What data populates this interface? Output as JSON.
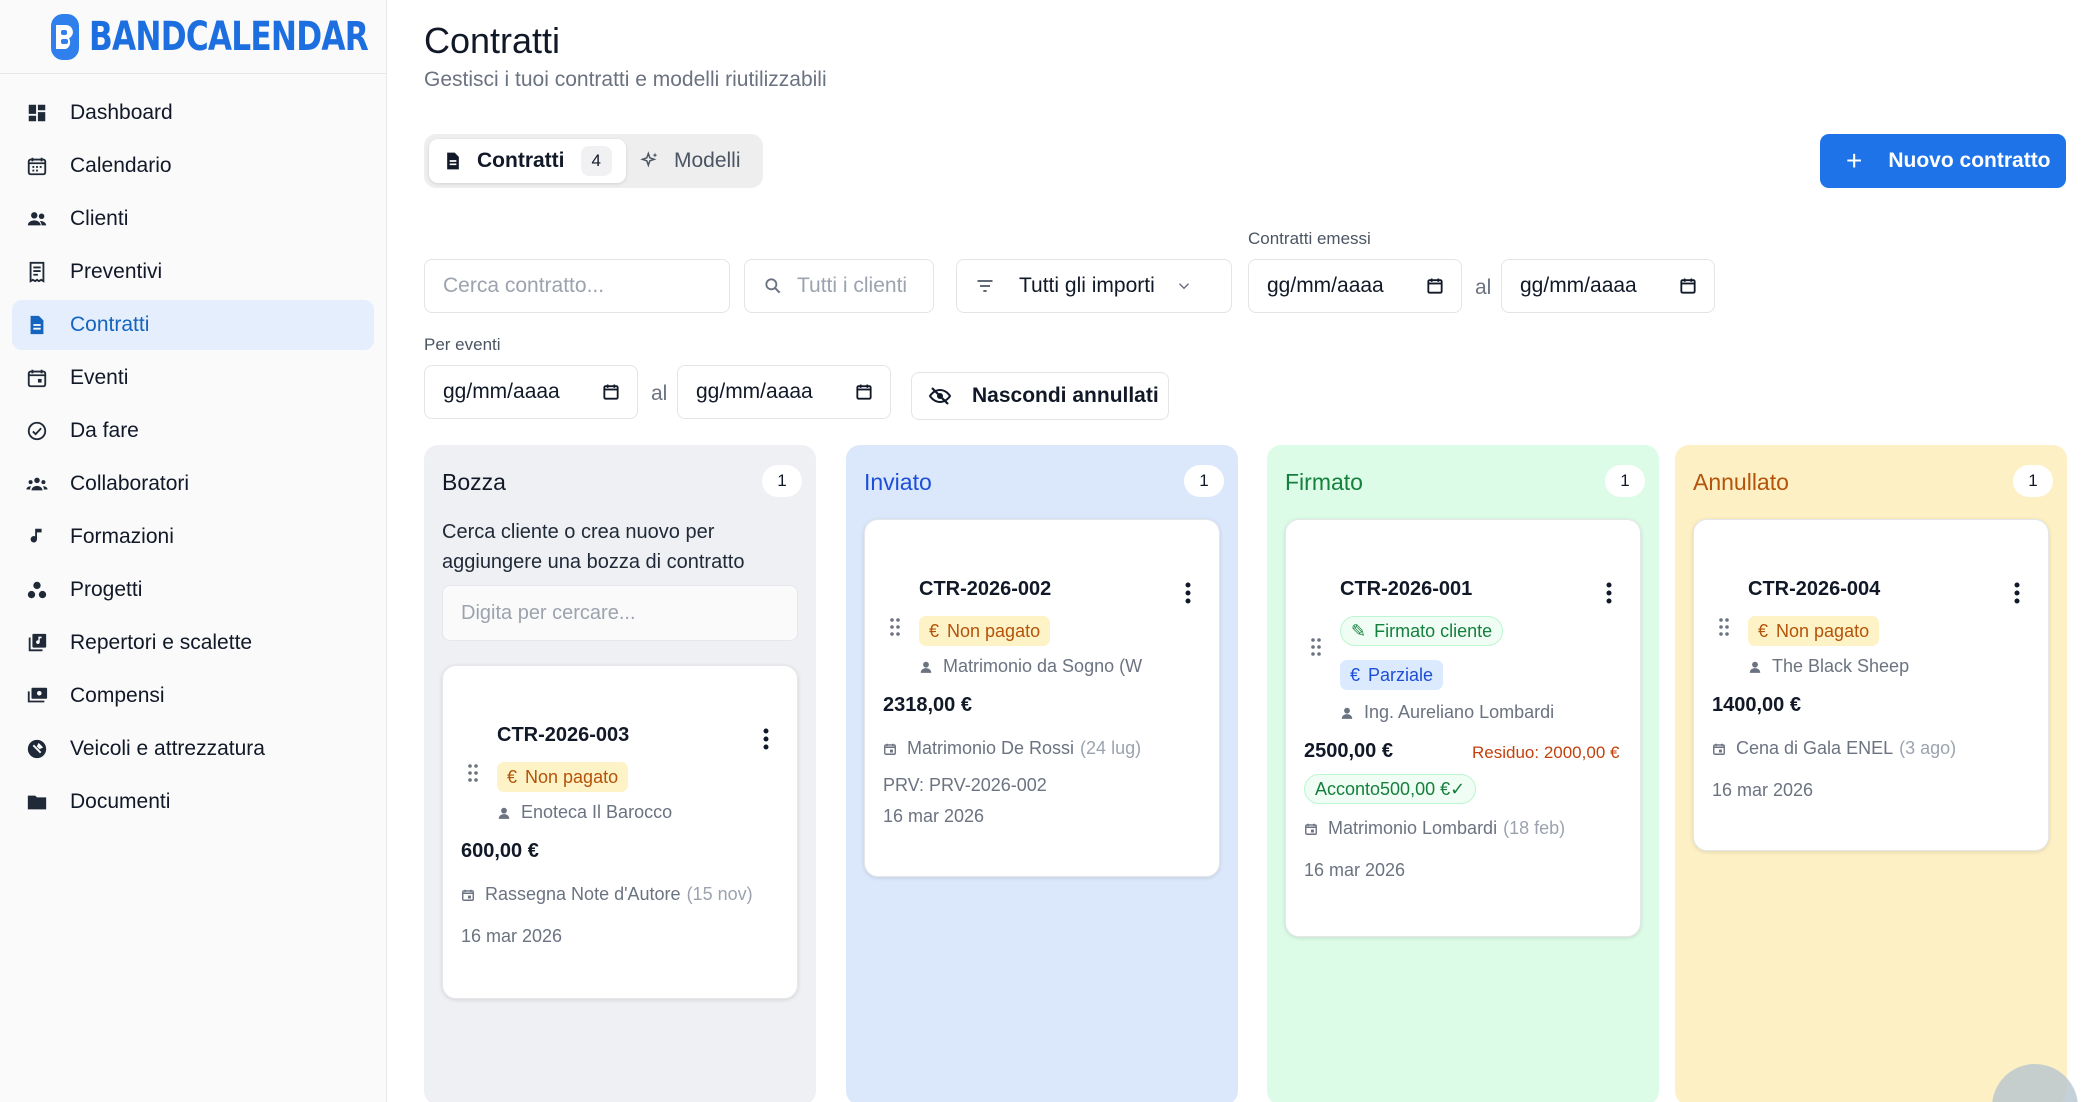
{
  "app": {
    "name": "BANDCALENDAR"
  },
  "sidebar": {
    "items": [
      {
        "label": "Dashboard",
        "icon": "dashboard-icon"
      },
      {
        "label": "Calendario",
        "icon": "calendar-icon"
      },
      {
        "label": "Clienti",
        "icon": "people-icon"
      },
      {
        "label": "Preventivi",
        "icon": "receipt-icon"
      },
      {
        "label": "Contratti",
        "icon": "document-icon",
        "active": true
      },
      {
        "label": "Eventi",
        "icon": "event-icon"
      },
      {
        "label": "Da fare",
        "icon": "check-circle-icon"
      },
      {
        "label": "Collaboratori",
        "icon": "group-icon"
      },
      {
        "label": "Formazioni",
        "icon": "music-note-icon"
      },
      {
        "label": "Progetti",
        "icon": "workspaces-icon"
      },
      {
        "label": "Repertori e scalette",
        "icon": "library-music-icon"
      },
      {
        "label": "Compensi",
        "icon": "payments-icon"
      },
      {
        "label": "Veicoli e attrezzatura",
        "icon": "tools-icon"
      },
      {
        "label": "Documenti",
        "icon": "folder-icon"
      }
    ]
  },
  "header": {
    "title": "Contratti",
    "subtitle": "Gestisci i tuoi contratti e modelli riutilizzabili"
  },
  "tabs": [
    {
      "label": "Contratti",
      "count": "4",
      "active": true
    },
    {
      "label": "Modelli"
    }
  ],
  "new_button": {
    "label": "Nuovo contratto"
  },
  "filters": {
    "search_placeholder": "Cerca contratto...",
    "clients_placeholder": "Tutti i clienti",
    "amount_select": "Tutti gli importi",
    "issued_label": "Contratti emessi",
    "events_label": "Per eventi",
    "date_placeholder": "gg/mm/aaaa",
    "range_sep": "al",
    "hide_cancelled": "Nascondi annullati"
  },
  "columns": [
    {
      "title": "Bozza",
      "count": "1",
      "color": "#eef0f3",
      "title_color": "#1f2937",
      "hint": "Cerca cliente o crea nuovo per aggiungere una bozza di contratto",
      "search_placeholder": "Digita per cercare...",
      "card": {
        "id": "CTR-2026-003",
        "status": "Non pagato",
        "client": "Enoteca Il Barocco",
        "amount": "600,00 €",
        "event": "Rassegna Note d'Autore",
        "event_date": "(15 nov)",
        "date": "16 mar 2026"
      }
    },
    {
      "title": "Inviato",
      "count": "1",
      "color": "#dbe8fb",
      "title_color": "#1d4ed8",
      "card": {
        "id": "CTR-2026-002",
        "status": "Non pagato",
        "client": "Matrimonio da Sogno (W",
        "amount": "2318,00 €",
        "event": "Matrimonio De Rossi",
        "event_date": "(24 lug)",
        "quote": "PRV: PRV-2026-002",
        "date": "16 mar 2026"
      }
    },
    {
      "title": "Firmato",
      "count": "1",
      "color": "#dcfce7",
      "title_color": "#15803d",
      "card": {
        "id": "CTR-2026-001",
        "signed": "Firmato cliente",
        "status": "Parziale",
        "client": "Ing. Aureliano Lombardi",
        "amount": "2500,00 €",
        "residuo": "Residuo: 2000,00 €",
        "deposit": "Acconto500,00 €✓",
        "event": "Matrimonio Lombardi",
        "event_date": "(18 feb)",
        "date": "16 mar 2026"
      }
    },
    {
      "title": "Annullato",
      "count": "1",
      "color": "#fdf0c4",
      "title_color": "#b45309",
      "card": {
        "id": "CTR-2026-004",
        "status": "Non pagato",
        "client": "The Black Sheep",
        "amount": "1400,00 €",
        "event": "Cena di Gala ENEL",
        "event_date": "(3 ago)",
        "date": "16 mar 2026"
      }
    }
  ]
}
